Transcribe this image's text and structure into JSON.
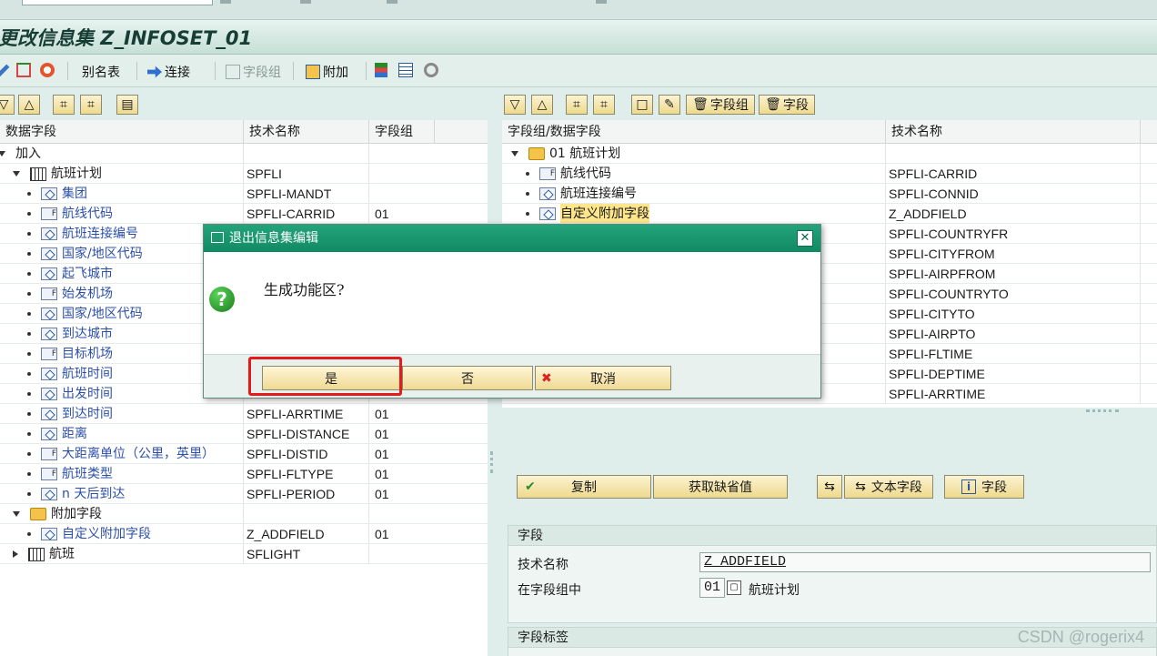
{
  "title": "更改信息集 Z_INFOSET_01",
  "toolbar": {
    "alias_table": "别名表",
    "join": "连接",
    "field_group": "字段组",
    "extras": "附加"
  },
  "left_tree": {
    "headers": [
      "数据字段",
      "技术名称",
      "字段组"
    ],
    "rows": [
      {
        "label": "加入",
        "tech": "",
        "group": ""
      },
      {
        "label": "航班计划",
        "tech": "SPFLI",
        "group": ""
      },
      {
        "label": "集团",
        "tech": "SPFLI-MANDT",
        "group": ""
      },
      {
        "label": "航线代码",
        "tech": "SPFLI-CARRID",
        "group": "01"
      },
      {
        "label": "航班连接编号",
        "tech": "",
        "group": ""
      },
      {
        "label": "国家/地区代码",
        "tech": "",
        "group": ""
      },
      {
        "label": "起飞城市",
        "tech": "",
        "group": ""
      },
      {
        "label": "始发机场",
        "tech": "",
        "group": ""
      },
      {
        "label": "国家/地区代码",
        "tech": "",
        "group": ""
      },
      {
        "label": "到达城市",
        "tech": "",
        "group": ""
      },
      {
        "label": "目标机场",
        "tech": "",
        "group": ""
      },
      {
        "label": "航班时间",
        "tech": "",
        "group": ""
      },
      {
        "label": "出发时间",
        "tech": "",
        "group": ""
      },
      {
        "label": "到达时间",
        "tech": "SPFLI-ARRTIME",
        "group": "01"
      },
      {
        "label": "距离",
        "tech": "SPFLI-DISTANCE",
        "group": "01"
      },
      {
        "label": "大距离单位（公里，英里）",
        "tech": "SPFLI-DISTID",
        "group": "01"
      },
      {
        "label": "航班类型",
        "tech": "SPFLI-FLTYPE",
        "group": "01"
      },
      {
        "label": "n 天后到达",
        "tech": "SPFLI-PERIOD",
        "group": "01"
      },
      {
        "label": "附加字段",
        "tech": "",
        "group": ""
      },
      {
        "label": "自定义附加字段",
        "tech": "Z_ADDFIELD",
        "group": "01"
      },
      {
        "label": "航班",
        "tech": "SFLIGHT",
        "group": ""
      }
    ]
  },
  "right_toolbar": {
    "field_group_btn": "字段组",
    "field_btn": "字段"
  },
  "right_tree": {
    "headers": [
      "字段组/数据字段",
      "技术名称"
    ],
    "rows": [
      {
        "label": "01 航班计划",
        "tech": ""
      },
      {
        "label": "航线代码",
        "tech": "SPFLI-CARRID"
      },
      {
        "label": "航班连接编号",
        "tech": "SPFLI-CONNID"
      },
      {
        "label": "自定义附加字段",
        "tech": "Z_ADDFIELD"
      },
      {
        "label": "",
        "tech": "SPFLI-COUNTRYFR"
      },
      {
        "label": "",
        "tech": "SPFLI-CITYFROM"
      },
      {
        "label": "",
        "tech": "SPFLI-AIRPFROM"
      },
      {
        "label": "",
        "tech": "SPFLI-COUNTRYTO"
      },
      {
        "label": "",
        "tech": "SPFLI-CITYTO"
      },
      {
        "label": "",
        "tech": "SPFLI-AIRPTO"
      },
      {
        "label": "",
        "tech": "SPFLI-FLTIME"
      },
      {
        "label": "",
        "tech": "SPFLI-DEPTIME"
      },
      {
        "label": "",
        "tech": "SPFLI-ARRTIME"
      }
    ]
  },
  "buttons": {
    "copy": "复制",
    "get_default": "获取缺省值",
    "text_field": "文本字段",
    "field": "字段"
  },
  "field_section": {
    "header": "字段",
    "tech_name_label": "技术名称",
    "tech_name_value": "Z_ADDFIELD",
    "in_group_label": "在字段组中",
    "group_value": "01",
    "group_text": "航班计划"
  },
  "label_section": {
    "header": "字段标签"
  },
  "dialog": {
    "title": "退出信息集编辑",
    "question": "生成功能区?",
    "yes": "是",
    "no": "否",
    "cancel": "取消"
  },
  "watermark": "CSDN @rogerix4"
}
